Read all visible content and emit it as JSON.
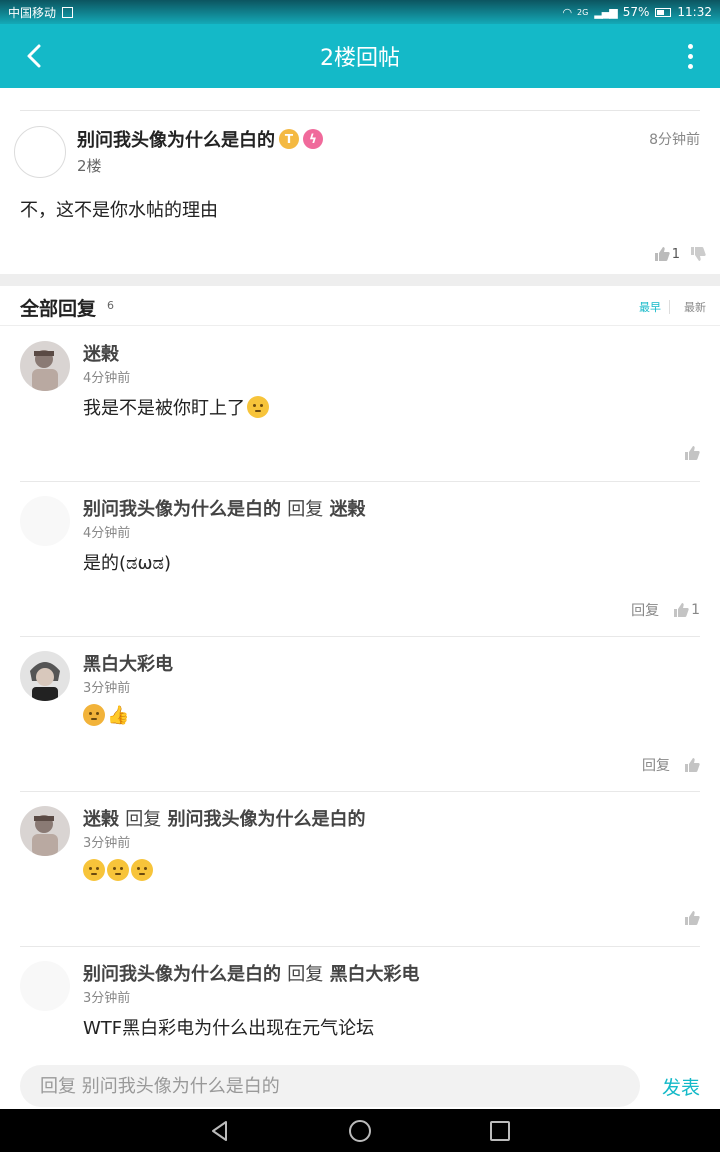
{
  "status_bar": {
    "carrier": "中国移动",
    "network": "2G",
    "battery": "57%",
    "battery_level": 0.57,
    "time": "11:32"
  },
  "app_bar": {
    "title": "2楼回帖",
    "back_icon": "chevron-left-icon",
    "more_icon": "more-vertical-icon"
  },
  "post": {
    "author": "别问我头像为什么是白的",
    "floor": "2楼",
    "time": "8分钟前",
    "content": "不，这不是你水帖的理由",
    "likes": "1",
    "badges": [
      {
        "icon": "t-badge-icon",
        "text": "T",
        "color": "#f4b942"
      },
      {
        "icon": "bolt-badge-icon",
        "text": "ϟ",
        "color": "#f06a9b"
      }
    ]
  },
  "replies_header": {
    "title": "全部回复",
    "count": "6",
    "sort_earliest": "最早",
    "sort_latest": "最新"
  },
  "replies": [
    {
      "author": "迷榖",
      "reply_word": "",
      "target": "",
      "time": "4分钟前",
      "text": "我是不是被你盯上了",
      "emojis": [
        "face-emoji"
      ],
      "reply_label": "",
      "likes": "",
      "avatar": "photo"
    },
    {
      "author": "别问我头像为什么是白的",
      "reply_word": "回复",
      "target": "迷榖",
      "time": "4分钟前",
      "text": "是的(ಡωಡ)",
      "emojis": [],
      "reply_label": "回复",
      "likes": "1",
      "avatar": "blank"
    },
    {
      "author": "黑白大彩电",
      "reply_word": "",
      "target": "",
      "time": "3分钟前",
      "text": "",
      "emojis": [
        "face-emoji",
        "thumbs-up-emoji"
      ],
      "reply_label": "回复",
      "likes": "",
      "avatar": "photo"
    },
    {
      "author": "迷榖",
      "reply_word": "回复",
      "target": "别问我头像为什么是白的",
      "time": "3分钟前",
      "text": "",
      "emojis": [
        "face-emoji",
        "face-emoji",
        "face-emoji"
      ],
      "reply_label": "",
      "likes": "",
      "avatar": "photo"
    },
    {
      "author": "别问我头像为什么是白的",
      "reply_word": "回复",
      "target": "黑白大彩电",
      "time": "3分钟前",
      "text": "WTF黑白彩电为什么出现在元气论坛",
      "emojis": [],
      "reply_label": "",
      "likes": "",
      "avatar": "blank"
    }
  ],
  "input_bar": {
    "placeholder": "回复 别问我头像为什么是白的",
    "send_label": "发表"
  },
  "colors": {
    "accent": "#14b9c8",
    "nav_background": "#000000"
  }
}
